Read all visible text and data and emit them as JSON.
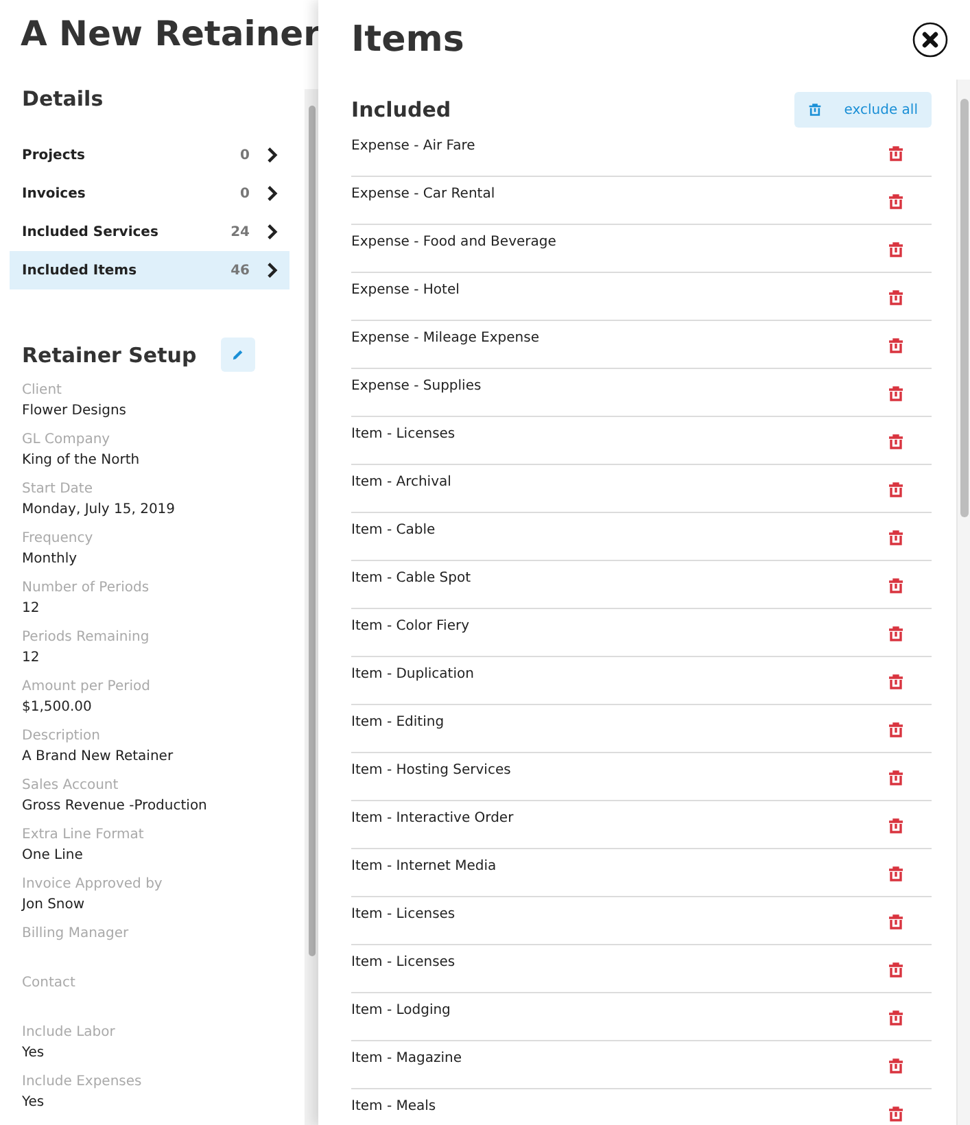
{
  "page_title": "A New Retainer",
  "details": {
    "heading": "Details",
    "items": [
      {
        "label": "Projects",
        "count": "0",
        "selected": false
      },
      {
        "label": "Invoices",
        "count": "0",
        "selected": false
      },
      {
        "label": "Included Services",
        "count": "24",
        "selected": false
      },
      {
        "label": "Included Items",
        "count": "46",
        "selected": true
      }
    ]
  },
  "setup": {
    "heading": "Retainer Setup",
    "fields": [
      {
        "label": "Client",
        "value": "Flower Designs"
      },
      {
        "label": "GL Company",
        "value": "King of the North"
      },
      {
        "label": "Start Date",
        "value": "Monday, July 15, 2019"
      },
      {
        "label": "Frequency",
        "value": "Monthly"
      },
      {
        "label": "Number of Periods",
        "value": "12"
      },
      {
        "label": "Periods Remaining",
        "value": "12"
      },
      {
        "label": "Amount per Period",
        "value": "$1,500.00"
      },
      {
        "label": "Description",
        "value": "A Brand New Retainer"
      },
      {
        "label": "Sales Account",
        "value": "Gross Revenue -Production"
      },
      {
        "label": "Extra Line Format",
        "value": "One Line"
      },
      {
        "label": "Invoice Approved by",
        "value": "Jon Snow"
      },
      {
        "label": "Billing Manager"
      },
      {
        "label": "Contact"
      },
      {
        "label": "Include Labor",
        "value": "Yes"
      },
      {
        "label": "Include Expenses",
        "value": "Yes"
      }
    ]
  },
  "panel": {
    "title": "Items",
    "section": "Included",
    "exclude_all": "exclude all",
    "items": [
      "Expense - Air Fare",
      "Expense - Car Rental",
      "Expense - Food and Beverage",
      "Expense - Hotel",
      "Expense - Mileage Expense",
      "Expense - Supplies",
      "Item - Licenses",
      "Item - Archival",
      "Item - Cable",
      "Item - Cable Spot",
      "Item - Color Fiery",
      "Item - Duplication",
      "Item - Editing",
      "Item - Hosting Services",
      "Item - Interactive Order",
      "Item - Internet Media",
      "Item - Licenses",
      "Item - Licenses",
      "Item - Lodging",
      "Item - Magazine",
      "Item - Meals"
    ]
  }
}
